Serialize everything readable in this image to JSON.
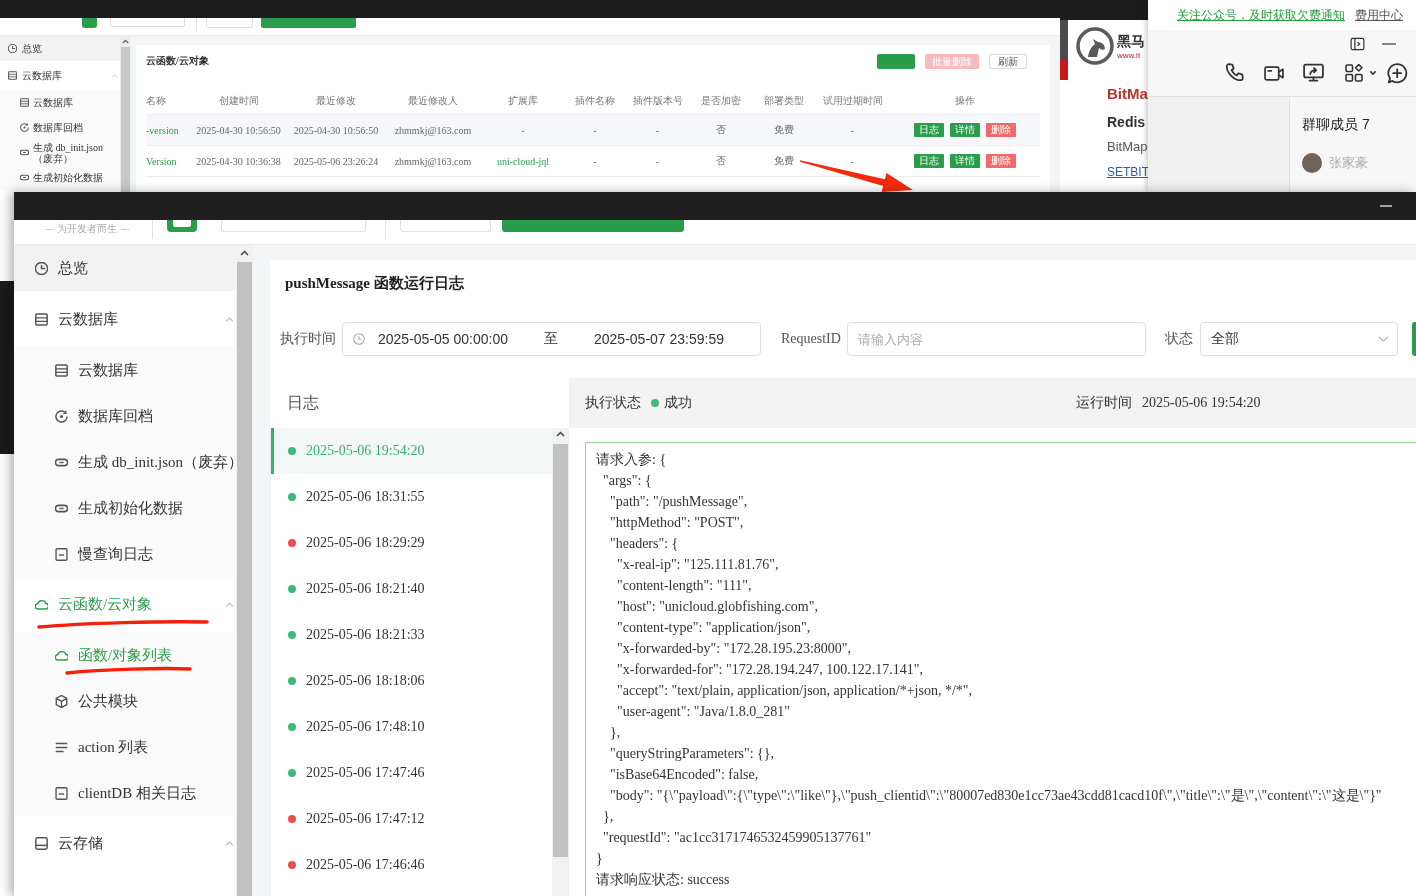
{
  "background_window": {
    "sidebar": [
      {
        "label": "总览",
        "kind": "overview",
        "hovered": true,
        "active": false
      },
      {
        "label": "云数据库",
        "kind": "table",
        "hovered": false,
        "active": false,
        "expanded": true,
        "children": [
          {
            "label": "云数据库",
            "kind": "table",
            "selected": false
          },
          {
            "label": "数据库回档",
            "kind": "restore",
            "selected": false
          },
          {
            "label": "生成 db_init.json（废弃）",
            "kind": "link",
            "selected": false
          },
          {
            "label": "生成初始化数据",
            "kind": "link",
            "selected": false
          }
        ]
      }
    ],
    "title": "云函数/云对象",
    "buttons": [
      {
        "kind": "primary",
        "disabled": false
      },
      {
        "label": "批量删除",
        "kind": "danger",
        "disabled": true
      },
      {
        "label": "刷新",
        "kind": "plain",
        "disabled": false
      }
    ],
    "table": {
      "columns": [
        {
          "label": "名称",
          "kind": "link"
        },
        {
          "label": "创建时间",
          "kind": "text"
        },
        {
          "label": "最近修改",
          "kind": "text"
        },
        {
          "label": "最近修改人",
          "kind": "text"
        },
        {
          "label": "扩展库",
          "kind": "link"
        },
        {
          "label": "插件名称",
          "kind": "text"
        },
        {
          "label": "插件版本号",
          "kind": "text"
        },
        {
          "label": "是否加密",
          "kind": "text"
        },
        {
          "label": "部署类型",
          "kind": "text"
        },
        {
          "label": "试用过期时间",
          "kind": "text"
        },
        {
          "label": "操作",
          "kind": "actions"
        }
      ],
      "rows": [
        {
          "cells": [
            "-version",
            "2025-04-30 10:56:50",
            "2025-04-30 10:56:50",
            "zhmmkj@163.com",
            "-",
            "-",
            "-",
            "否",
            "免费",
            "-"
          ],
          "actions": [
            {
              "label": "日志",
              "kind": "primary"
            },
            {
              "label": "详情",
              "kind": "primary"
            },
            {
              "label": "删除",
              "kind": "danger"
            }
          ]
        },
        {
          "cells": [
            "Version",
            "2025-04-30 10:36:38",
            "2025-05-06 23:26:24",
            "zhmmkj@163.com",
            "uni-cloud-jql",
            "-",
            "-",
            "否",
            "免费",
            "-"
          ],
          "actions": [
            {
              "label": "日志",
              "kind": "primary"
            },
            {
              "label": "详情",
              "kind": "primary"
            },
            {
              "label": "删除",
              "kind": "danger"
            }
          ]
        }
      ]
    }
  },
  "side_window": {
    "logo_text": "黑马",
    "logo_subtext": "www.it",
    "heading": "BitMa",
    "subheading": "Redis",
    "text": "BitMap",
    "link": "SETBIT"
  },
  "chat_window": {
    "banner_link": "关注公众号，及时获取欠费通知",
    "banner_text": "费用中心",
    "members_title": "群聊成员 7",
    "members": [
      {
        "name": "张家豪"
      }
    ]
  },
  "window": {
    "header": {
      "tagline": "为开发者而生"
    },
    "sidebar": [
      {
        "label": "总览",
        "kind": "overview",
        "hovered": true,
        "active": false
      },
      {
        "label": "云数据库",
        "kind": "table",
        "hovered": false,
        "active": false,
        "expanded": true,
        "children": [
          {
            "label": "云数据库",
            "kind": "table",
            "selected": false
          },
          {
            "label": "数据库回档",
            "kind": "restore",
            "selected": false
          },
          {
            "label": "生成 db_init.json（废弃）",
            "kind": "link",
            "selected": false
          },
          {
            "label": "生成初始化数据",
            "kind": "link",
            "selected": false
          },
          {
            "label": "慢查询日志",
            "kind": "log",
            "selected": false
          }
        ]
      },
      {
        "label": "云函数/云对象",
        "kind": "cloud",
        "hovered": false,
        "active": true,
        "expanded": true,
        "children": [
          {
            "label": "函数/对象列表",
            "kind": "cloud",
            "selected": true
          },
          {
            "label": "公共模块",
            "kind": "cube",
            "selected": false
          },
          {
            "label": "action 列表",
            "kind": "list",
            "selected": false
          },
          {
            "label": "clientDB 相关日志",
            "kind": "log",
            "selected": false
          }
        ]
      },
      {
        "label": "云存储",
        "kind": "drive",
        "hovered": false,
        "active": false,
        "expanded": true
      }
    ],
    "title": "pushMessage 函数运行日志",
    "filters": {
      "time": {
        "label": "执行时间",
        "start": "2025-05-05 00:00:00",
        "separator": "至",
        "end": "2025-05-07 23:59:59"
      },
      "request_id": {
        "label": "RequestID",
        "placeholder": "请输入内容"
      },
      "status": {
        "label": "状态",
        "value": "全部"
      }
    },
    "log_list": {
      "title": "日志",
      "items": [
        {
          "time": "2025-05-06 19:54:20",
          "color": "#3dbb78",
          "selected": true
        },
        {
          "time": "2025-05-06 18:31:55",
          "color": "#3dbb78",
          "selected": false
        },
        {
          "time": "2025-05-06 18:29:29",
          "color": "#ee4b4b",
          "selected": false
        },
        {
          "time": "2025-05-06 18:21:40",
          "color": "#3dbb78",
          "selected": false
        },
        {
          "time": "2025-05-06 18:21:33",
          "color": "#3dbb78",
          "selected": false
        },
        {
          "time": "2025-05-06 18:18:06",
          "color": "#3dbb78",
          "selected": false
        },
        {
          "time": "2025-05-06 17:48:10",
          "color": "#3dbb78",
          "selected": false
        },
        {
          "time": "2025-05-06 17:47:46",
          "color": "#3dbb78",
          "selected": false
        },
        {
          "time": "2025-05-06 17:47:12",
          "color": "#ee4b4b",
          "selected": false
        },
        {
          "time": "2025-05-06 17:46:46",
          "color": "#ee4b4b",
          "selected": false
        }
      ]
    },
    "detail": {
      "status_label": "执行状态",
      "status": "成功",
      "success": true,
      "time_label": "运行时间",
      "time": "2025-05-06 19:54:20",
      "text": "请求入参: {\n  \"args\": {\n    \"path\": \"/pushMessage\",\n    \"httpMethod\": \"POST\",\n    \"headers\": {\n      \"x-real-ip\": \"125.111.81.76\",\n      \"content-length\": \"111\",\n      \"host\": \"unicloud.globfishing.com\",\n      \"content-type\": \"application/json\",\n      \"x-forwarded-by\": \"172.28.195.23:8000\",\n      \"x-forwarded-for\": \"172.28.194.247, 100.122.17.141\",\n      \"accept\": \"text/plain, application/json, application/*+json, */*\",\n      \"user-agent\": \"Java/1.8.0_281\"\n    },\n    \"queryStringParameters\": {},\n    \"isBase64Encoded\": false,\n    \"body\": \"{\\\"payload\\\":{\\\"type\\\":\\\"like\\\"},\\\"push_clientid\\\":\\\"80007ed830e1cc73ae43cdd81cacd10f\\\",\\\"title\\\":\\\"是\\\",\\\"content\\\":\\\"这是\\\"}\"\n  },\n  \"requestId\": \"ac1cc3171746532459905137761\"\n}\n请求响应状态: success"
    }
  }
}
